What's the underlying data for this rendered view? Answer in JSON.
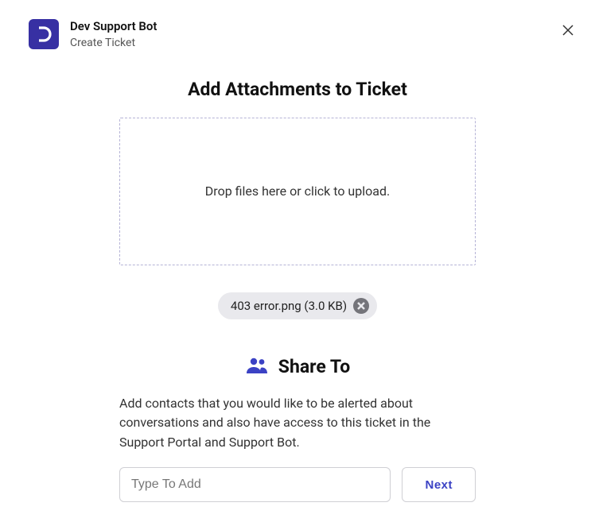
{
  "header": {
    "title": "Dev Support Bot",
    "subtitle": "Create Ticket"
  },
  "attachments": {
    "title": "Add Attachments to Ticket",
    "dropzone_text": "Drop files here or click to upload.",
    "files": [
      {
        "label": "403 error.png (3.0 KB)"
      }
    ]
  },
  "share": {
    "title": "Share To",
    "description": "Add contacts that you would like to be alerted about conversations and also have access to this ticket in the Support Portal and Support Bot.",
    "input_placeholder": "Type To Add",
    "next_label": "Next"
  }
}
